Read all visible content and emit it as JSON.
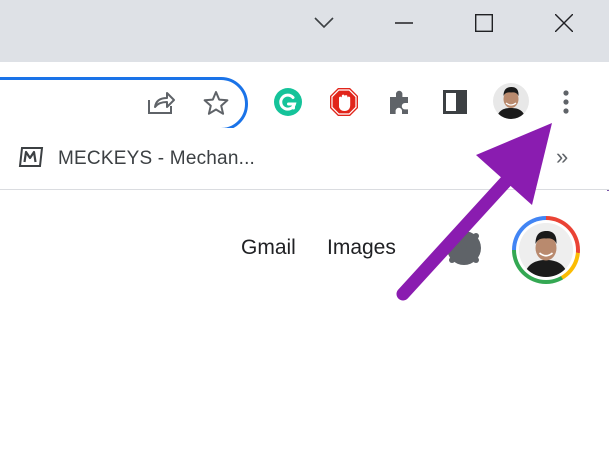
{
  "window_controls": {
    "tab_search_icon": "chevron-down-icon",
    "minimize_icon": "minimize-icon",
    "maximize_icon": "maximize-icon",
    "close_icon": "close-icon"
  },
  "toolbar": {
    "icons": [
      "share-icon",
      "star-icon",
      "grammarly-icon",
      "adblock-icon",
      "extensions-icon",
      "side-panel-icon",
      "profile-avatar-icon",
      "more-menu-icon"
    ],
    "grammarly_color": "#15c39a",
    "adblock_color": "#e1251b",
    "omnibox_border_color": "#1a73e8"
  },
  "bookmarks": {
    "items": [
      {
        "label": "MECKEYS - Mechan...",
        "icon": "meckeys-favicon-icon"
      }
    ],
    "overflow_label": "»"
  },
  "page": {
    "links": [
      {
        "label": "Gmail"
      },
      {
        "label": "Images"
      }
    ],
    "apps_icon": "google-apps-icon",
    "account_avatar_icon": "google-account-avatar-icon"
  },
  "annotation": {
    "arrow_color": "#8a1cb0",
    "points_to": "more-menu-icon"
  }
}
